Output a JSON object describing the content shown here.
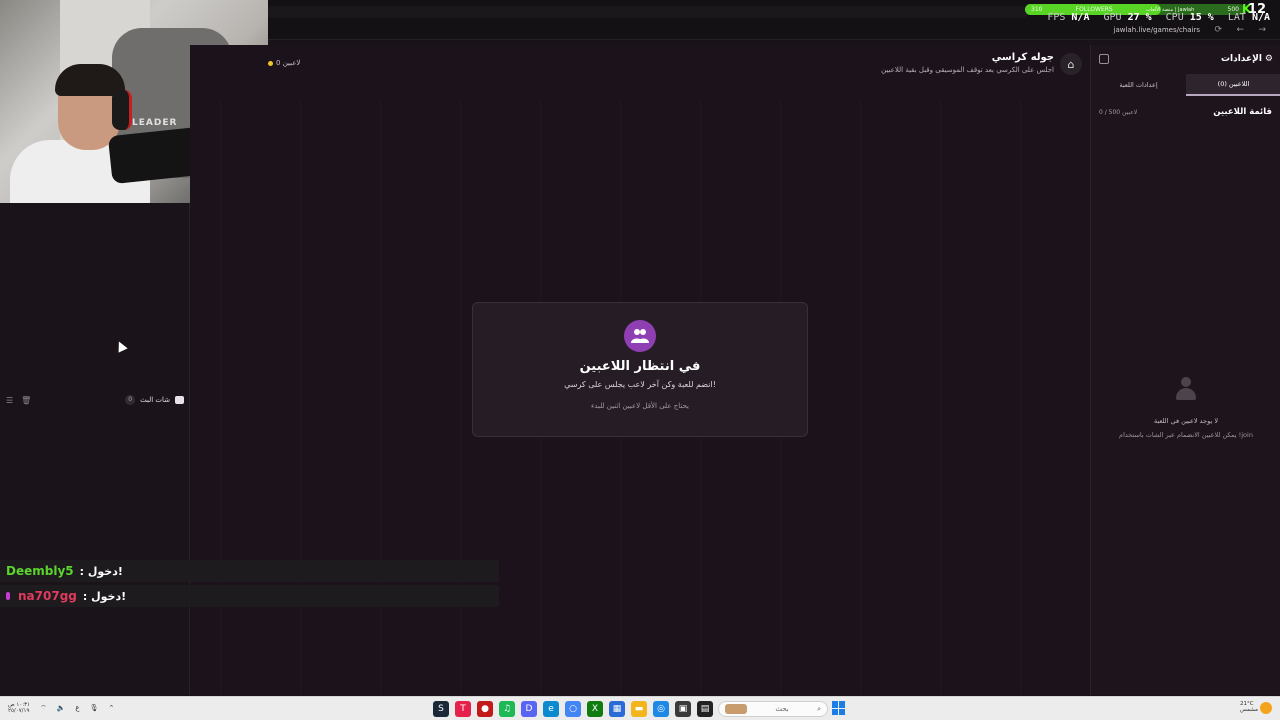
{
  "browser": {
    "url": "jawlah.live/games/chairs"
  },
  "overlay": {
    "fps_label": "FPS",
    "fps_value": "N/A",
    "gpu_label": "GPU",
    "gpu_value": "27 %",
    "cpu_label": "CPU",
    "cpu_value": "15 %",
    "lat_label": "LAT",
    "lat_value": "N/A",
    "followers_label": "FOLLOWERS",
    "followers_current": "310",
    "followers_goal": "500",
    "followers_progress": 0.62,
    "followers_caption": "منصة الألعاب | Jawlah",
    "kick_count": "12"
  },
  "webcam": {
    "chair_text": "LEADER"
  },
  "left_panel": {
    "chat_title": "شات البث",
    "chat_count": "0"
  },
  "chat": [
    {
      "user": "Deembly5",
      "message": ": دخول!",
      "color": "#5bd52c"
    },
    {
      "user": "na707gg",
      "message": ": دخول!",
      "color": "#e03a5e"
    }
  ],
  "game": {
    "title": "جوله كراسي",
    "subtitle": "اجلس على الكرسي بعد توقف الموسيقى وقبل بقية اللاعبين",
    "player_count": "0 لاعبين",
    "wait_title": "في انتظار اللاعبين",
    "wait_sub": "انضم للعبة وكن آخر لاعب يجلس على كرسي!",
    "wait_note": "يحتاج على الأقل لاعبين اثنين للبدء"
  },
  "settings": {
    "title": "الإعدادات",
    "tabs": [
      "اللاعبين (0)",
      "إعدادات اللعبة"
    ],
    "list_title": "قائمة اللاعبين",
    "list_count": "0 / 500 لاعبين",
    "empty_title": "لا يوجد لاعبين في اللعبة",
    "empty_hint": "يمكن للاعبين الانضمام عبر الشات باستخدام !join"
  },
  "taskbar": {
    "search_placeholder": "بحث",
    "time": "١٠:٣١ ص",
    "date": "٢٥/٠٧/١٩",
    "weather_temp": "21°C",
    "weather_desc": "مشمس"
  },
  "colors": {
    "accent": "#8f3fb3",
    "kick_green": "#53fc18",
    "background": "#1c121b"
  }
}
